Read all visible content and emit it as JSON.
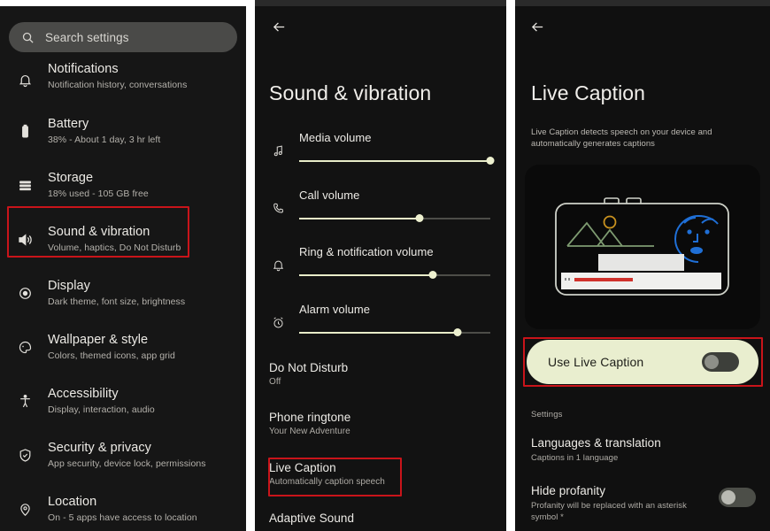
{
  "panels": {
    "settings": {
      "search": {
        "placeholder": "Search settings",
        "icon": "search-icon"
      },
      "items": [
        {
          "icon": "bell-icon",
          "title": "Notifications",
          "subtitle": "Notification history, conversations"
        },
        {
          "icon": "battery-icon",
          "title": "Battery",
          "subtitle": "38% - About 1 day, 3 hr left"
        },
        {
          "icon": "storage-icon",
          "title": "Storage",
          "subtitle": "18% used - 105 GB free"
        },
        {
          "icon": "volume-icon",
          "title": "Sound & vibration",
          "subtitle": "Volume, haptics, Do Not Disturb"
        },
        {
          "icon": "brightness-icon",
          "title": "Display",
          "subtitle": "Dark theme, font size, brightness"
        },
        {
          "icon": "palette-icon",
          "title": "Wallpaper & style",
          "subtitle": "Colors, themed icons, app grid"
        },
        {
          "icon": "accessibility-icon",
          "title": "Accessibility",
          "subtitle": "Display, interaction, audio"
        },
        {
          "icon": "shield-icon",
          "title": "Security & privacy",
          "subtitle": "App security, device lock, permissions"
        },
        {
          "icon": "location-pin-icon",
          "title": "Location",
          "subtitle": "On - 5 apps have access to location"
        }
      ]
    },
    "sound": {
      "back_icon": "back-arrow-icon",
      "title": "Sound & vibration",
      "volumes": [
        {
          "icon": "music-note-icon",
          "label": "Media volume",
          "value": 100
        },
        {
          "icon": "phone-icon",
          "label": "Call volume",
          "value": 63
        },
        {
          "icon": "bell-icon",
          "label": "Ring & notification volume",
          "value": 70
        },
        {
          "icon": "alarm-icon",
          "label": "Alarm volume",
          "value": 83
        }
      ],
      "rows": [
        {
          "title": "Do Not Disturb",
          "subtitle": "Off"
        },
        {
          "title": "Phone ringtone",
          "subtitle": "Your New Adventure"
        },
        {
          "title": "Live Caption",
          "subtitle": "Automatically caption speech"
        },
        {
          "title": "Adaptive Sound",
          "subtitle": ""
        }
      ]
    },
    "caption": {
      "back_icon": "back-arrow-icon",
      "title": "Live Caption",
      "description": "Live Caption detects speech on your device and automatically generates captions",
      "illustration": "live-caption-illustration",
      "toggle_card": {
        "label": "Use Live Caption",
        "state": "off"
      },
      "section_label": "Settings",
      "rows": [
        {
          "title": "Languages & translation",
          "subtitle": "Captions in 1 language",
          "has_toggle": false
        },
        {
          "title": "Hide profanity",
          "subtitle": "Profanity will be replaced with an asterisk symbol *",
          "has_toggle": true,
          "state": "off"
        }
      ]
    }
  },
  "annotations": {
    "highlight_color": "#c9141a",
    "boxes": [
      {
        "name": "sound-vibration-highlight"
      },
      {
        "name": "live-caption-highlight"
      },
      {
        "name": "use-live-caption-highlight"
      }
    ]
  }
}
